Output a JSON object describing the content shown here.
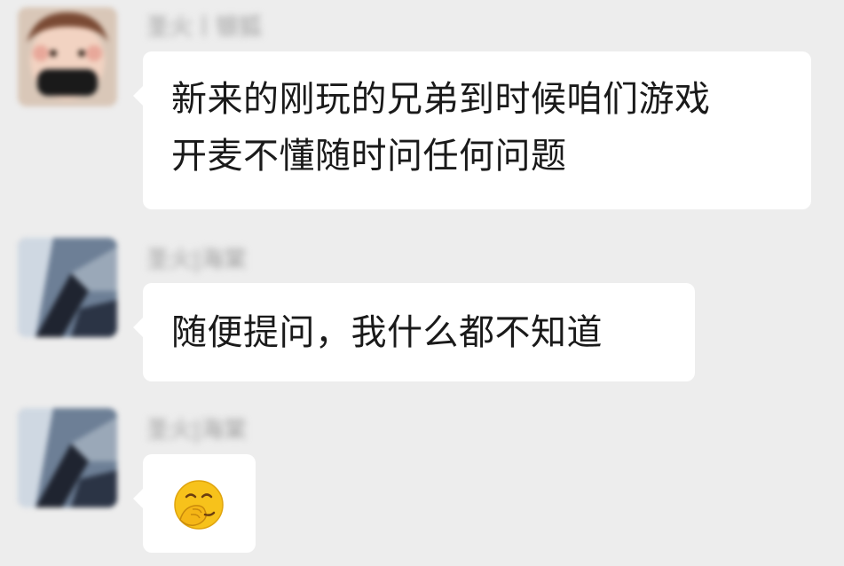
{
  "messages": [
    {
      "sender": "圣火丨银狐",
      "avatar_icon": "cartoon-face-avatar-icon",
      "text": "新来的刚玩的兄弟到时候咱们游戏\n开麦不懂随时问任何问题"
    },
    {
      "sender": "圣火|海棠",
      "avatar_icon": "blurred-photo-avatar-icon",
      "text": "随便提问，我什么都不知道"
    },
    {
      "sender": "圣火|海棠",
      "avatar_icon": "blurred-photo-avatar-icon",
      "emoji": "facepalm-smile-emoji-icon"
    }
  ],
  "colors": {
    "background": "#ededed",
    "bubble": "#ffffff",
    "text": "#1a1a1a",
    "sender": "#9c9c9c",
    "emoji_yellow": "#f7c21b"
  }
}
